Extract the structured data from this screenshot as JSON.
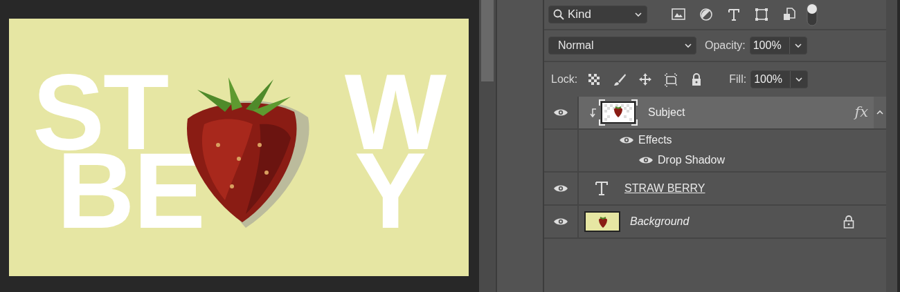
{
  "canvas": {
    "lines": [
      {
        "segments": [
          "ST",
          "W"
        ]
      },
      {
        "segments": [
          "BE",
          "Y"
        ]
      }
    ]
  },
  "filter": {
    "label": "Kind",
    "toggle_on": true
  },
  "blend": {
    "value": "Normal",
    "opacity_label": "Opacity:",
    "opacity_value": "100%"
  },
  "lock": {
    "label": "Lock:",
    "fill_label": "Fill:",
    "fill_value": "100%"
  },
  "layers": [
    {
      "name": "Subject",
      "kind": "smart",
      "selected": true,
      "visible": true,
      "clipped": true,
      "fx": "fx",
      "expanded": true,
      "effects": {
        "label": "Effects",
        "visible": true,
        "items": [
          {
            "name": "Drop Shadow",
            "visible": true
          }
        ]
      }
    },
    {
      "name": "STRAW BERRY",
      "kind": "text",
      "selected": false,
      "visible": true,
      "clipped": false
    },
    {
      "name": "Background",
      "kind": "background",
      "selected": false,
      "visible": true,
      "clipped": false,
      "locked": true
    }
  ]
}
